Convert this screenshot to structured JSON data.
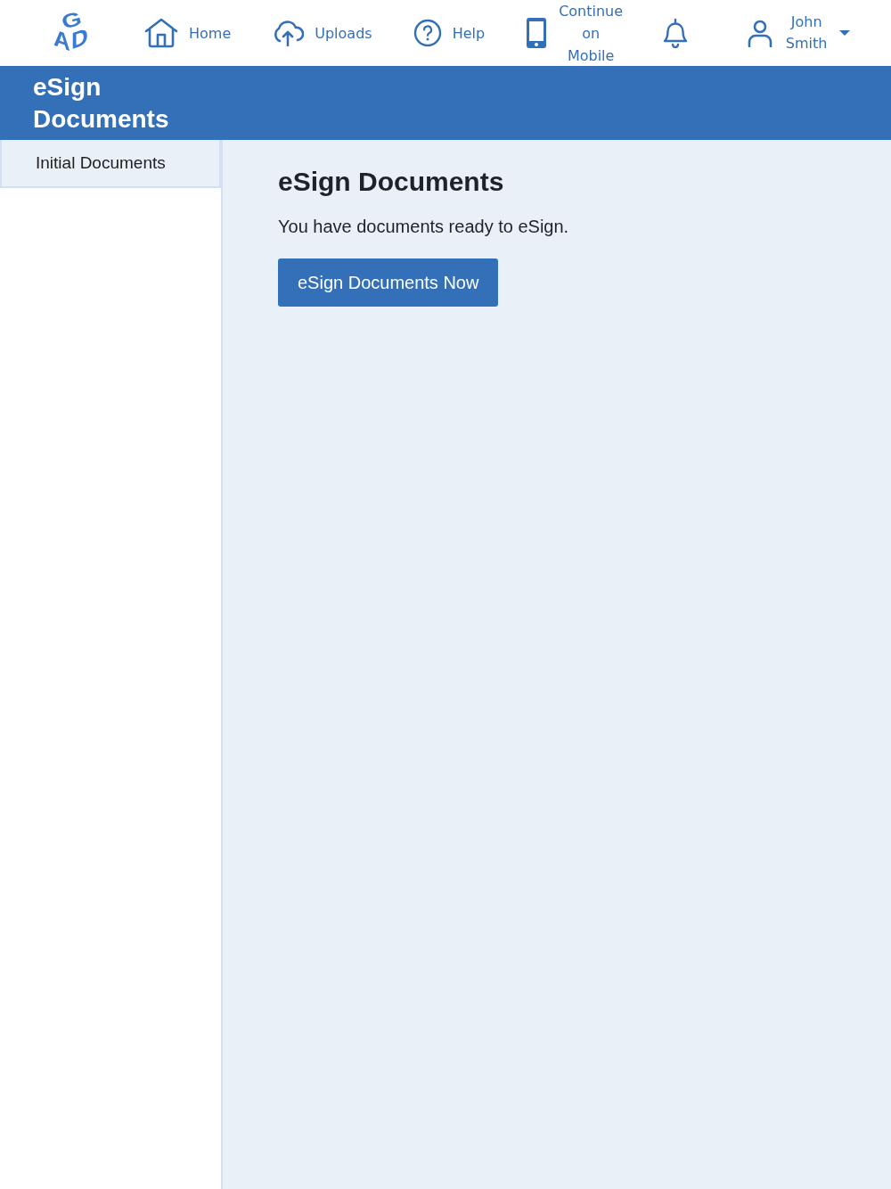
{
  "logo": {
    "letters": [
      "G",
      "A",
      "D"
    ]
  },
  "nav": [
    {
      "kind": "home",
      "label": "Home"
    },
    {
      "kind": "upload",
      "label": "Uploads"
    },
    {
      "kind": "help",
      "label": "Help"
    },
    {
      "kind": "mobile",
      "label": "Continue on Mobile"
    },
    {
      "kind": "bell"
    },
    {
      "kind": "user",
      "label": "John Smith"
    }
  ],
  "banner": {
    "title": "eSign Documents"
  },
  "sidebar": {
    "items": [
      {
        "label": "Initial Documents",
        "selected": true
      }
    ]
  },
  "main": {
    "heading": "eSign Documents",
    "message": "You have documents ready to eSign.",
    "button": "eSign Documents Now"
  }
}
